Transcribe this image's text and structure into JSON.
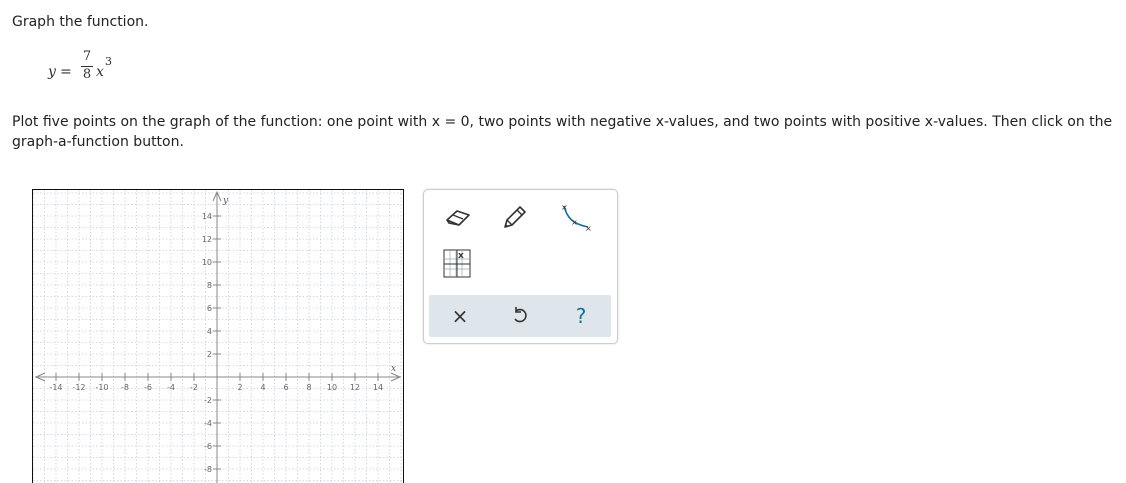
{
  "question": {
    "instruction": "Graph the function.",
    "equation": {
      "lhs": "y",
      "equals": "=",
      "numerator": "7",
      "denominator": "8",
      "variable": "x",
      "exponent": "3"
    },
    "prompt": "Plot five points on the graph of the function: one point with x = 0, two points with negative x-values, and two points with positive x-values. Then click on the graph-a-function button."
  },
  "chart_data": {
    "type": "scatter",
    "title": "",
    "xlabel": "x",
    "ylabel": "y",
    "xlim": [
      -16,
      16
    ],
    "ylim": [
      -10,
      16
    ],
    "grid": true,
    "x_ticks": [
      -14,
      -12,
      -10,
      -8,
      -6,
      -4,
      -2,
      2,
      4,
      6,
      8,
      10,
      12,
      14
    ],
    "y_ticks": [
      14,
      12,
      10,
      8,
      6,
      4,
      2,
      -2,
      -4,
      -6,
      -8
    ],
    "series": []
  },
  "toolbox": {
    "tools": [
      {
        "name": "eraser-tool",
        "icon": "eraser-icon"
      },
      {
        "name": "pencil-tool",
        "icon": "pencil-icon"
      },
      {
        "name": "curve-tool",
        "icon": "curve-icon"
      },
      {
        "name": "graph-function-tool",
        "icon": "graph-function-icon"
      }
    ],
    "actions": {
      "clear_icon": "×",
      "reset_icon": "reset-icon",
      "help_icon": "?"
    }
  },
  "colors": {
    "grid_minor": "#c9ced6",
    "axis": "#888888",
    "tool_bar": "#dfe6eb",
    "curve_tool": "#1a6f97"
  }
}
